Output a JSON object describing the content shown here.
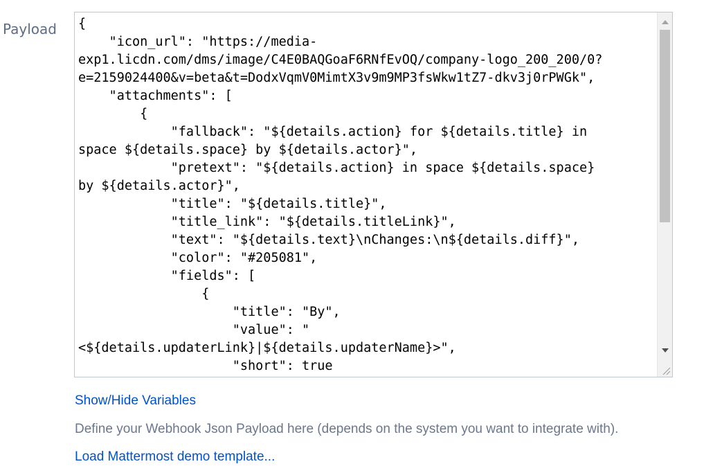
{
  "field": {
    "label": "Payload"
  },
  "payload": {
    "lines": [
      "{",
      "    \"icon_url\": \"https://media-",
      "exp1.licdn.com/dms/image/C4E0BAQGoaF6RNfEvOQ/company-logo_200_200/0?",
      "e=2159024400&v=beta&t=DodxVqmV0MimtX3v9m9MP3fsWkw1tZ7-dkv3j0rPWGk\",",
      "    \"attachments\": [",
      "        {",
      "            \"fallback\": \"${details.action} for ${details.title} in",
      "space ${details.space} by ${details.actor}\",",
      "            \"pretext\": \"${details.action} in space ${details.space}",
      "by ${details.actor}\",",
      "            \"title\": \"${details.title}\",",
      "            \"title_link\": \"${details.titleLink}\",",
      "            \"text\": \"${details.text}\\nChanges:\\n${details.diff}\",",
      "            \"color\": \"#205081\",",
      "            \"fields\": [",
      "                {",
      "                    \"title\": \"By\",",
      "                    \"value\": \"",
      "<${details.updaterLink}|${details.updaterName}>\",",
      "                    \"short\": true"
    ]
  },
  "links": {
    "show_hide": "Show/Hide Variables",
    "load_demo": "Load Mattermost demo template..."
  },
  "help": {
    "text": "Define your Webhook Json Payload here (depends on the system you want to integrate with)."
  },
  "icons": {
    "scroll_up": "triangle-up-icon",
    "scroll_down": "triangle-down-icon",
    "resize": "resize-grip-icon"
  },
  "colors": {
    "link": "#0052cc",
    "label": "#5e6c84",
    "help": "#6b778c",
    "scroll_thumb": "#c1c1c1"
  }
}
